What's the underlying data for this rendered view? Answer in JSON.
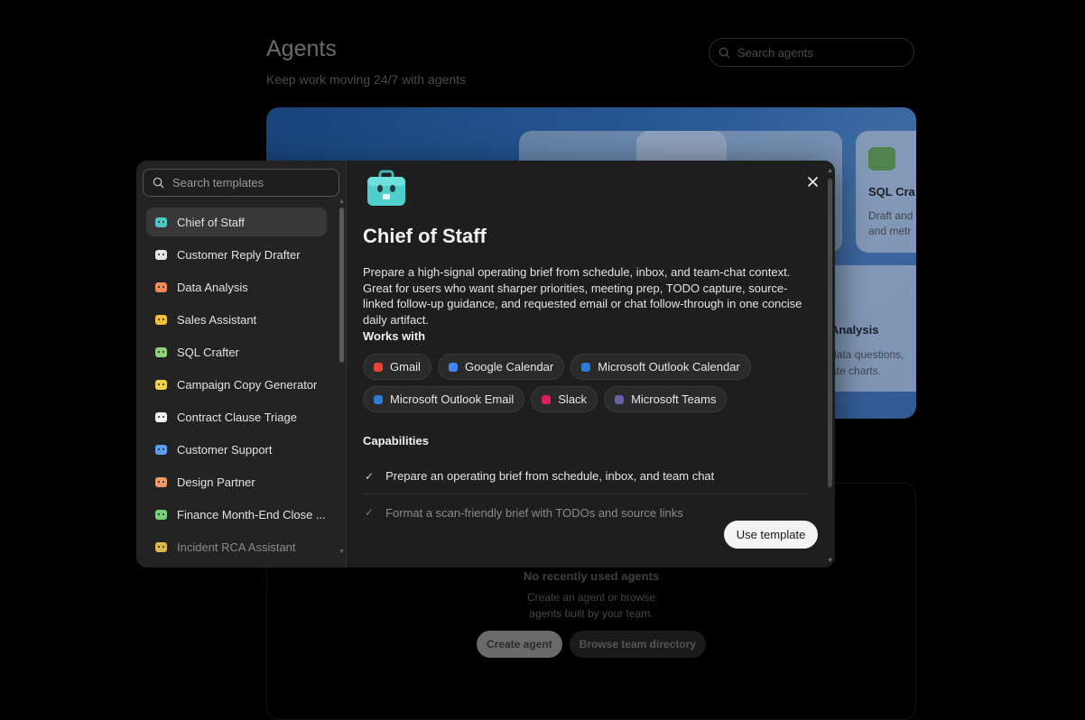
{
  "background": {
    "title": "Agents",
    "subtitle": "Keep work moving 24/7 with agents",
    "search_placeholder": "Search agents",
    "featured_cards": [
      {
        "title": "SQL Cra",
        "desc": "Draft and and metr"
      },
      {
        "title": "Analysis",
        "desc": "data questions, ate charts."
      }
    ],
    "recent": {
      "empty_title": "No recently used agents",
      "empty_text_line1": "Create an agent or browse",
      "empty_text_line2": "agents built by your team.",
      "create_label": "Create agent",
      "browse_label": "Browse team directory"
    }
  },
  "modal": {
    "search_placeholder": "Search templates",
    "templates": [
      {
        "label": "Chief of Staff",
        "color": "#4fc9c7"
      },
      {
        "label": "Customer Reply Drafter",
        "color": "#e6e6e6"
      },
      {
        "label": "Data Analysis",
        "color": "#f08a5a"
      },
      {
        "label": "Sales Assistant",
        "color": "#f0c23a"
      },
      {
        "label": "SQL Crafter",
        "color": "#8fd27a"
      },
      {
        "label": "Campaign Copy Generator",
        "color": "#f0cf4a"
      },
      {
        "label": "Contract Clause Triage",
        "color": "#f2f2f2"
      },
      {
        "label": "Customer Support",
        "color": "#5aa0f0"
      },
      {
        "label": "Design Partner",
        "color": "#f09a6a"
      },
      {
        "label": "Finance Month-End Close ...",
        "color": "#7ad07a"
      },
      {
        "label": "Incident RCA Assistant",
        "color": "#e0b84a"
      }
    ],
    "detail": {
      "title": "Chief of Staff",
      "description": "Prepare a high-signal operating brief from schedule, inbox, and team-chat context. Great for users who want sharper priorities, meeting prep, TODO capture, source-linked follow-up guidance, and requested email or chat follow-through in one concise daily artifact.",
      "works_with_heading": "Works with",
      "integrations": [
        {
          "label": "Gmail",
          "color": "#ea4335",
          "icon": "gmail-icon"
        },
        {
          "label": "Google Calendar",
          "color": "#4285f4",
          "icon": "google-calendar-icon"
        },
        {
          "label": "Microsoft Outlook Calendar",
          "color": "#2b7cd3",
          "icon": "outlook-calendar-icon"
        },
        {
          "label": "Microsoft Outlook Email",
          "color": "#2b7cd3",
          "icon": "outlook-email-icon"
        },
        {
          "label": "Slack",
          "color": "#e01e5a",
          "icon": "slack-icon"
        },
        {
          "label": "Microsoft Teams",
          "color": "#6264a7",
          "icon": "teams-icon"
        }
      ],
      "capabilities_heading": "Capabilities",
      "capabilities": [
        "Prepare an operating brief from schedule, inbox, and team chat",
        "Format a scan-friendly brief with TODOs and source links"
      ],
      "use_template_label": "Use template"
    }
  }
}
